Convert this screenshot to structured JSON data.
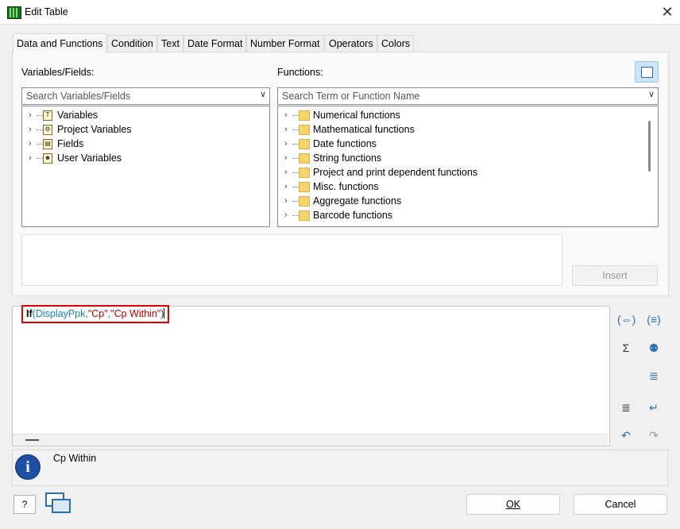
{
  "window": {
    "title": "Edit Table",
    "close_glyph": "✕"
  },
  "tabs": [
    {
      "label": "Data and Functions",
      "active": true
    },
    {
      "label": "Condition"
    },
    {
      "label": "Text"
    },
    {
      "label": "Date Format"
    },
    {
      "label": "Number Format"
    },
    {
      "label": "Operators"
    },
    {
      "label": "Colors"
    }
  ],
  "variables": {
    "label": "Variables/Fields:",
    "search_placeholder": "Search Variables/Fields",
    "items": [
      {
        "label": "Variables",
        "icon": "variables-icon",
        "glyph": "T"
      },
      {
        "label": "Project Variables",
        "icon": "project-variables-icon",
        "glyph": "⚙"
      },
      {
        "label": "Fields",
        "icon": "fields-icon",
        "glyph": "▤"
      },
      {
        "label": "User Variables",
        "icon": "user-variables-icon",
        "glyph": "☻"
      }
    ]
  },
  "functions": {
    "label": "Functions:",
    "search_placeholder": "Search Term or Function Name",
    "items": [
      {
        "label": "Numerical functions"
      },
      {
        "label": "Mathematical functions"
      },
      {
        "label": "Date functions"
      },
      {
        "label": "String functions"
      },
      {
        "label": "Project and print dependent functions"
      },
      {
        "label": "Misc. functions"
      },
      {
        "label": "Aggregate functions"
      },
      {
        "label": "Barcode functions"
      }
    ]
  },
  "insert_label": "Insert",
  "formula": {
    "func": "If",
    "open": "(",
    "arg1": "DisplayPpk",
    "sep1": ",",
    "arg2": "\"Cp\"",
    "sep2": ",",
    "arg3": "\"Cp Within\"",
    "close": ")"
  },
  "info_text": "Cp Within",
  "ok_label": "OK",
  "cancel_label": "Cancel",
  "colors": {
    "highlight": "#e00000",
    "field": "#1a7fc1",
    "string": "#c00000",
    "accent": "#2c6fb0"
  }
}
